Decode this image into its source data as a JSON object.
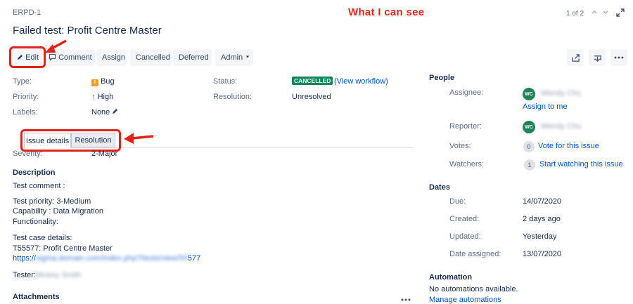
{
  "issue": {
    "key": "ERPD-1",
    "title": "Failed test: Profit Centre Master",
    "pager": "1 of 2"
  },
  "annotation": "What I can see",
  "toolbar": {
    "edit": "Edit",
    "comment": "Comment",
    "assign": "Assign",
    "cancelled": "Cancelled",
    "deferred": "Deferred",
    "admin": "Admin"
  },
  "details": {
    "type_label": "Type:",
    "type_value": "Bug",
    "priority_label": "Priority:",
    "priority_value": "High",
    "labels_label": "Labels:",
    "labels_value": "None",
    "status_label": "Status:",
    "status_value": "CANCELLED",
    "view_workflow": "(View workflow)",
    "resolution_label": "Resolution:",
    "resolution_value": "Unresolved"
  },
  "tabs": [
    "Issue details",
    "Resolution"
  ],
  "severity": {
    "label": "Severity:",
    "value": "2-Major"
  },
  "description": {
    "heading": "Description",
    "line1": "Test comment :",
    "line2": "Test priority: 3-Medium",
    "line3": "Capability : Data Migration",
    "line4": "Functionality:",
    "line5": "Test case details:",
    "line6": "T55577: Profit Centre Master",
    "link_prefix": "https://",
    "link_blurred": "sigma.domain.com/index.php?/tests/view/55",
    "link_suffix": "577",
    "tester_label": "Tester:",
    "tester_blurred": "Mickey Smith"
  },
  "attachments": {
    "heading": "Attachments"
  },
  "people": {
    "heading": "People",
    "assignee_label": "Assignee:",
    "assignee_initials": "WC",
    "assignee_name": "Wendy Chu",
    "assign_to_me": "Assign to me",
    "reporter_label": "Reporter:",
    "reporter_initials": "WC",
    "reporter_name": "Wendy Chu",
    "votes_label": "Votes:",
    "votes_count": "0",
    "vote_link": "Vote for this issue",
    "watchers_label": "Watchers:",
    "watchers_count": "1",
    "watch_link": "Start watching this issue"
  },
  "dates": {
    "heading": "Dates",
    "due_label": "Due:",
    "due_value": "14/07/2020",
    "created_label": "Created:",
    "created_value": "2 days ago",
    "updated_label": "Updated:",
    "updated_value": "Yesterday",
    "assigned_label": "Date assigned:",
    "assigned_value": "13/07/2020"
  },
  "automation": {
    "heading": "Automation",
    "none_text": "No automations available.",
    "manage_link": "Manage automations"
  },
  "colors": {
    "annotation_red": "#e2231a",
    "status_green": "#00875a",
    "link_blue": "#0052cc",
    "bug_orange": "#ff991f",
    "priority_red": "#de350b"
  }
}
